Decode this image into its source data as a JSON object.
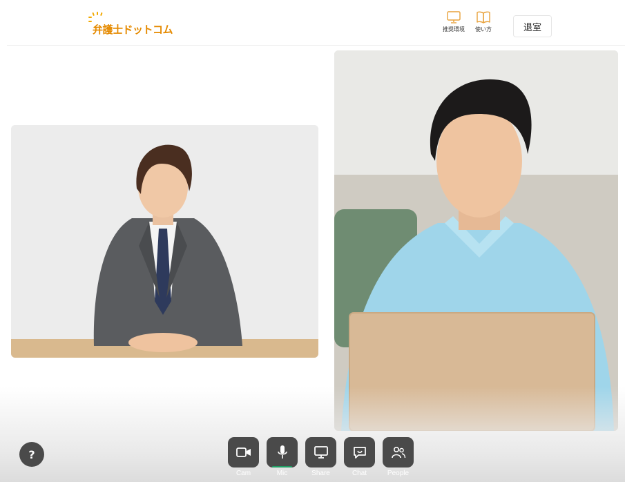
{
  "header": {
    "logo_text": "弁護士ドットコム",
    "links": [
      {
        "label": "推奨環境",
        "icon": "monitor-icon"
      },
      {
        "label": "使い方",
        "icon": "book-icon"
      }
    ],
    "leave_label": "退室"
  },
  "videos": [
    {
      "participant": "participant-suit",
      "description_icon": "video-tile"
    },
    {
      "participant": "participant-shirt",
      "description_icon": "video-tile"
    }
  ],
  "toolbar": {
    "help_label": "?",
    "buttons": [
      {
        "label": "Cam",
        "icon": "camera-icon",
        "active": false
      },
      {
        "label": "Mic",
        "icon": "microphone-icon",
        "active": true
      },
      {
        "label": "Share",
        "icon": "screen-share-icon",
        "active": false
      },
      {
        "label": "Chat",
        "icon": "chat-icon",
        "active": false
      },
      {
        "label": "People",
        "icon": "people-icon",
        "active": false
      }
    ]
  },
  "colors": {
    "brand": "#e58a00",
    "icon_accent": "#e8a13a",
    "control_bg": "#4a4a4a",
    "mic_active": "#1f9e63"
  }
}
